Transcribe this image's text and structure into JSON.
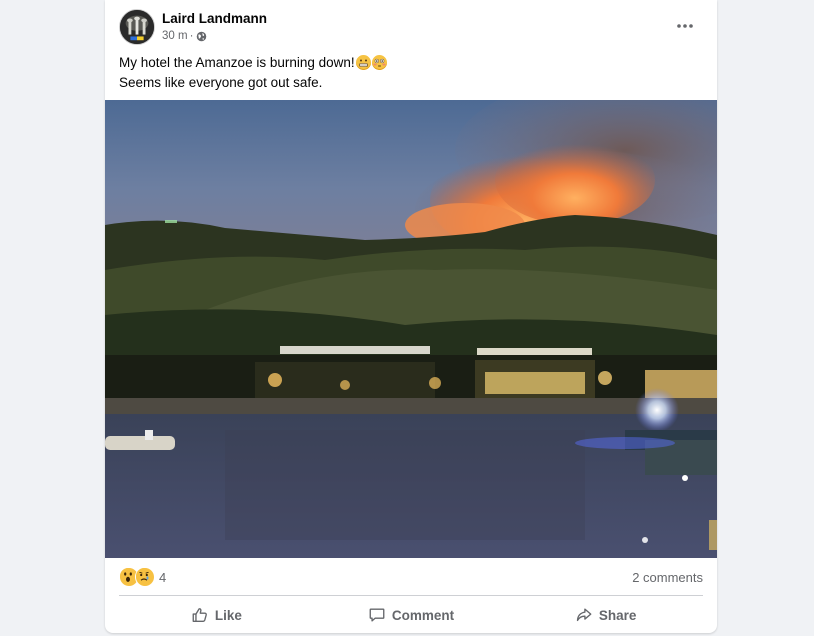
{
  "post": {
    "author": "Laird Landmann",
    "time": "30 m",
    "separator": "·",
    "visibility_icon": "globe-icon",
    "more_icon": "more-horizontal-icon",
    "text_line1": "My hotel the Amanzoe is burning down!",
    "text_line1_emojis": [
      "grimacing-face",
      "flushed-face"
    ],
    "text_line2": "Seems like everyone got out safe."
  },
  "reactions": {
    "icons": [
      "wow-reaction-icon",
      "sad-reaction-icon"
    ],
    "count": "4",
    "comments": "2 comments"
  },
  "actions": {
    "like": "Like",
    "comment": "Comment",
    "share": "Share"
  },
  "colors": {
    "accent_gray": "#65676b",
    "background": "#f0f2f5",
    "card": "#ffffff"
  }
}
